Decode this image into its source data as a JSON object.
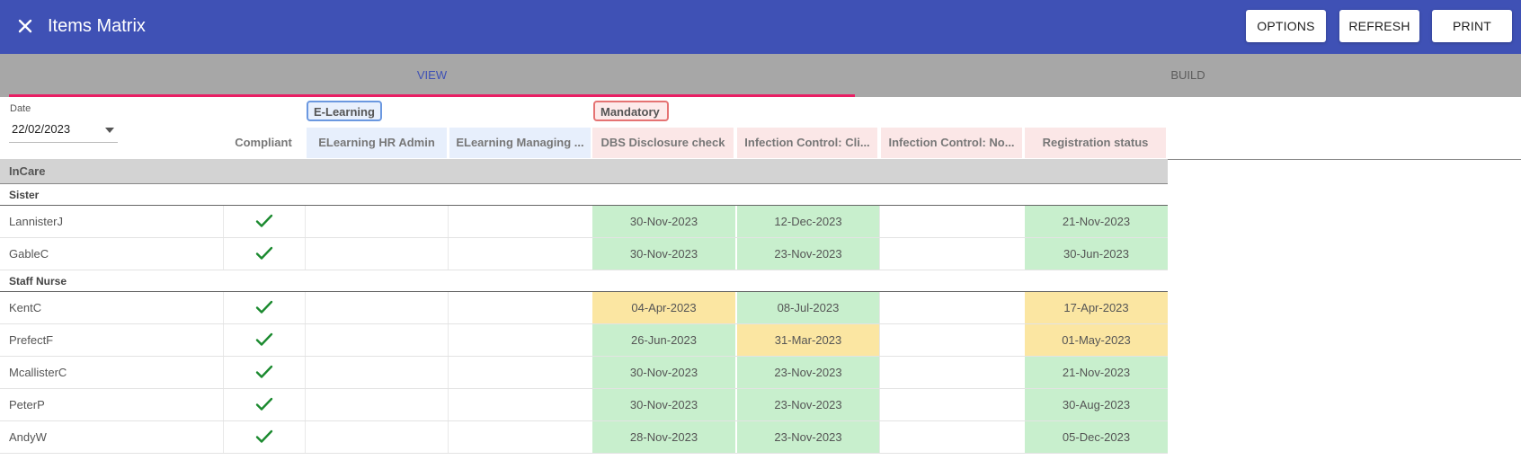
{
  "app": {
    "title": "Items Matrix"
  },
  "toolbar": {
    "options_label": "OPTIONS",
    "refresh_label": "REFRESH",
    "print_label": "PRINT"
  },
  "tabs": [
    {
      "label": "VIEW",
      "active": true
    },
    {
      "label": "BUILD",
      "active": false
    }
  ],
  "date_filter": {
    "label": "Date",
    "value": "22/02/2023"
  },
  "column_groups": [
    {
      "label": "E-Learning",
      "color": "#6b98e0"
    },
    {
      "label": "Mandatory",
      "color": "#e57373"
    }
  ],
  "columns": {
    "compliant": "Compliant",
    "items": [
      "ELearning HR Admin",
      "ELearning Managing ...",
      "DBS Disclosure check",
      "Infection Control: Cli...",
      "Infection Control: No...",
      "Registration status"
    ]
  },
  "status_colors": {
    "valid": "#c8efcd",
    "expiring": "#fbe6a2",
    "check": "#1b8a2f"
  },
  "organisation": "InCare",
  "groups": [
    {
      "name": "Sister",
      "rows": [
        {
          "name": "LannisterJ",
          "compliant": true,
          "cells": [
            "",
            "",
            "30-Nov-2023",
            "12-Dec-2023",
            "",
            "21-Nov-2023"
          ],
          "status": [
            "",
            "",
            "green",
            "green",
            "",
            "green"
          ]
        },
        {
          "name": "GableC",
          "compliant": true,
          "cells": [
            "",
            "",
            "30-Nov-2023",
            "23-Nov-2023",
            "",
            "30-Jun-2023"
          ],
          "status": [
            "",
            "",
            "green",
            "green",
            "",
            "green"
          ]
        }
      ]
    },
    {
      "name": "Staff Nurse",
      "rows": [
        {
          "name": "KentC",
          "compliant": true,
          "cells": [
            "",
            "",
            "04-Apr-2023",
            "08-Jul-2023",
            "",
            "17-Apr-2023"
          ],
          "status": [
            "",
            "",
            "yellow",
            "green",
            "",
            "yellow"
          ]
        },
        {
          "name": "PrefectF",
          "compliant": true,
          "cells": [
            "",
            "",
            "26-Jun-2023",
            "31-Mar-2023",
            "",
            "01-May-2023"
          ],
          "status": [
            "",
            "",
            "green",
            "yellow",
            "",
            "yellow"
          ]
        },
        {
          "name": "McallisterC",
          "compliant": true,
          "cells": [
            "",
            "",
            "30-Nov-2023",
            "23-Nov-2023",
            "",
            "21-Nov-2023"
          ],
          "status": [
            "",
            "",
            "green",
            "green",
            "",
            "green"
          ]
        },
        {
          "name": "PeterP",
          "compliant": true,
          "cells": [
            "",
            "",
            "30-Nov-2023",
            "23-Nov-2023",
            "",
            "30-Aug-2023"
          ],
          "status": [
            "",
            "",
            "green",
            "green",
            "",
            "green"
          ]
        },
        {
          "name": "AndyW",
          "compliant": true,
          "cells": [
            "",
            "",
            "28-Nov-2023",
            "23-Nov-2023",
            "",
            "05-Dec-2023"
          ],
          "status": [
            "",
            "",
            "green",
            "green",
            "",
            "green"
          ]
        }
      ]
    }
  ]
}
